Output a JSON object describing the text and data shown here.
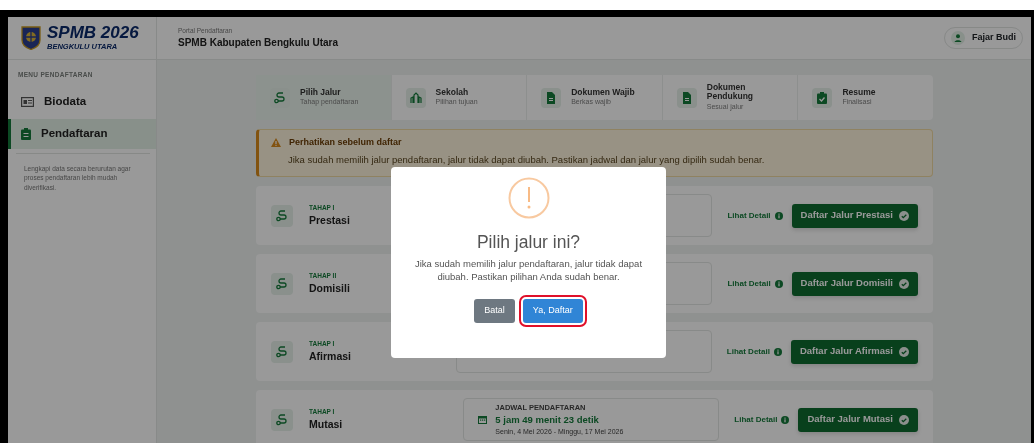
{
  "brand": {
    "title": "SPMB 2026",
    "subtitle": "BENGKULU UTARA"
  },
  "header": {
    "caption": "Portal Pendaftaran",
    "title": "SPMB Kabupaten Bengkulu Utara",
    "user": "Fajar Budi"
  },
  "sidebar": {
    "heading": "MENU PENDAFTARAN",
    "items": [
      {
        "label": "Biodata",
        "kind": "card",
        "selected": false
      },
      {
        "label": "Pendaftaran",
        "kind": "clipboard",
        "selected": true
      }
    ],
    "note": "Lengkapi data secara berurutan agar proses pendaftaran lebih mudah diverifikasi."
  },
  "steps": [
    {
      "title": "Pilih Jalur",
      "subtitle": "Tahap pendaftaran",
      "kind": "route",
      "selected": true
    },
    {
      "title": "Sekolah",
      "subtitle": "Pilihan tujuan",
      "kind": "school",
      "selected": false
    },
    {
      "title": "Dokumen Wajib",
      "subtitle": "Berkas wajib",
      "kind": "file",
      "selected": false
    },
    {
      "title": "Dokumen Pendukung",
      "subtitle": "Sesuai jalur",
      "kind": "file",
      "selected": false
    },
    {
      "title": "Resume",
      "subtitle": "Finalisasi",
      "kind": "check",
      "selected": false
    }
  ],
  "alert": {
    "title": "Perhatikan sebelum daftar",
    "text": "Jika sudah memilih jalur pendaftaran, jalur tidak dapat diubah. Pastikan jadwal dan jalur yang dipilih sudah benar."
  },
  "paths": [
    {
      "stage": "TAHAP I",
      "name": "Prestasi",
      "detail": "Lihat Detail",
      "action": "Daftar Jalur Prestasi"
    },
    {
      "stage": "TAHAP II",
      "name": "Domisili",
      "detail": "Lihat Detail",
      "action": "Daftar Jalur Domisili"
    },
    {
      "stage": "TAHAP I",
      "name": "Afirmasi",
      "detail": "Lihat Detail",
      "action": "Daftar Jalur Afirmasi"
    },
    {
      "stage": "TAHAP I",
      "name": "Mutasi",
      "detail": "Lihat Detail",
      "action": "Daftar Jalur Mutasi",
      "schedule": {
        "label": "JADWAL PENDAFTARAN",
        "countdown": "5 jam 49 menit 23 detik",
        "dates": "Senin, 4 Mei 2026 - Minggu, 17 Mei 2026"
      }
    }
  ],
  "dialog": {
    "title": "Pilih jalur ini?",
    "text": "Jika sudah memilih jalur pendaftaran, jalur tidak dapat diubah. Pastikan pilihan Anda sudah benar.",
    "buttons": [
      {
        "label": "Batal",
        "kind": "cancel",
        "highlighted": false
      },
      {
        "label": "Ya, Daftar",
        "kind": "confirm",
        "highlighted": true
      }
    ]
  }
}
